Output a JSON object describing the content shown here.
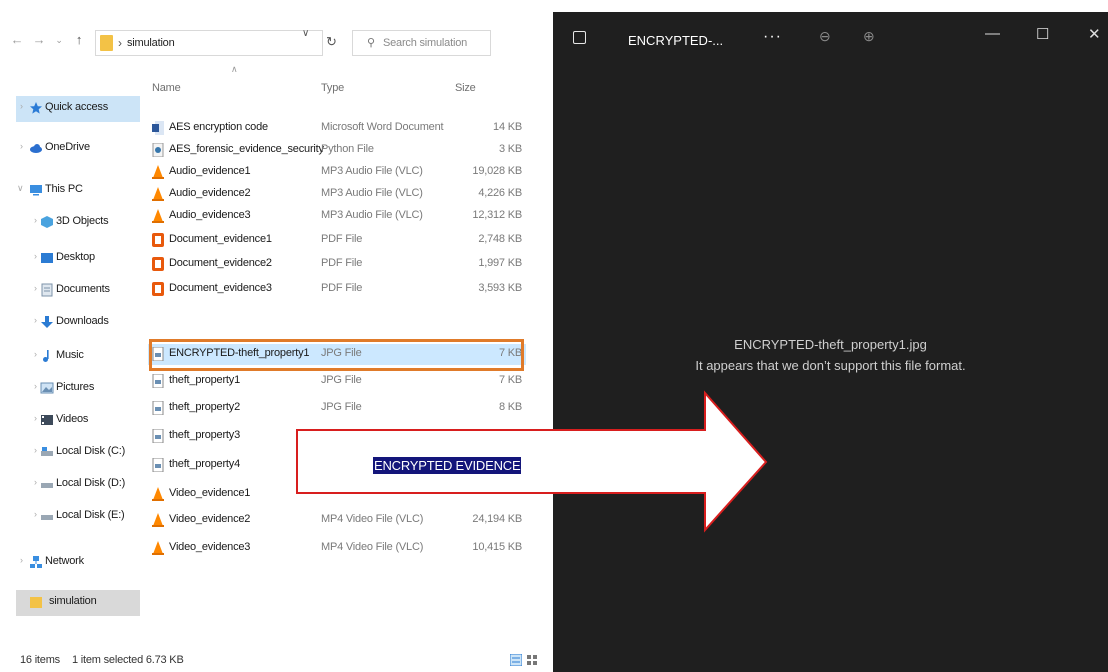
{
  "explorer": {
    "address": {
      "crumb": "simulation",
      "sep": "›"
    },
    "search": {
      "placeholder": "Search simulation"
    },
    "columns": {
      "name": "Name",
      "type": "Type",
      "size": "Size"
    },
    "nav": [
      {
        "label": "Quick access",
        "icon": "star-icon"
      },
      {
        "label": "OneDrive",
        "icon": "cloud-icon"
      },
      {
        "label": "This PC",
        "icon": "computer-icon"
      },
      {
        "label": "3D Objects",
        "icon": "cube-icon"
      },
      {
        "label": "Desktop",
        "icon": "desktop-icon"
      },
      {
        "label": "Documents",
        "icon": "document-icon"
      },
      {
        "label": "Downloads",
        "icon": "download-icon"
      },
      {
        "label": "Music",
        "icon": "music-icon"
      },
      {
        "label": "Pictures",
        "icon": "pictures-icon"
      },
      {
        "label": "Videos",
        "icon": "videos-icon"
      },
      {
        "label": "Local Disk (C:)",
        "icon": "disk-icon"
      },
      {
        "label": "Local Disk (D:)",
        "icon": "disk-icon"
      },
      {
        "label": "Local Disk (E:)",
        "icon": "disk-icon"
      },
      {
        "label": "Network",
        "icon": "network-icon"
      },
      {
        "label": "simulation",
        "icon": "folder-icon"
      }
    ],
    "files": [
      {
        "name": "AES encryption code",
        "type": "Microsoft Word Document",
        "size": "14 KB",
        "icon": "word-icon"
      },
      {
        "name": "AES_forensic_evidence_security",
        "type": "Python File",
        "size": "3 KB",
        "icon": "python-icon"
      },
      {
        "name": "Audio_evidence1",
        "type": "MP3 Audio File (VLC)",
        "size": "19,028 KB",
        "icon": "vlc-icon"
      },
      {
        "name": "Audio_evidence2",
        "type": "MP3 Audio File (VLC)",
        "size": "4,226 KB",
        "icon": "vlc-icon"
      },
      {
        "name": "Audio_evidence3",
        "type": "MP3 Audio File (VLC)",
        "size": "12,312 KB",
        "icon": "vlc-icon"
      },
      {
        "name": "Document_evidence1",
        "type": "PDF File",
        "size": "2,748 KB",
        "icon": "pdf-icon"
      },
      {
        "name": "Document_evidence2",
        "type": "PDF File",
        "size": "1,997 KB",
        "icon": "pdf-icon"
      },
      {
        "name": "Document_evidence3",
        "type": "PDF File",
        "size": "3,593 KB",
        "icon": "pdf-icon"
      },
      {
        "name": "ENCRYPTED-theft_property1",
        "type": "JPG File",
        "size": "7 KB",
        "icon": "image-icon"
      },
      {
        "name": "theft_property1",
        "type": "JPG File",
        "size": "7 KB",
        "icon": "image-icon"
      },
      {
        "name": "theft_property2",
        "type": "JPG File",
        "size": "8 KB",
        "icon": "image-icon"
      },
      {
        "name": "theft_property3",
        "type": "",
        "size": "",
        "icon": "image-icon"
      },
      {
        "name": "theft_property4",
        "type": "",
        "size": "",
        "icon": "image-icon"
      },
      {
        "name": "Video_evidence1",
        "type": "",
        "size": "",
        "icon": "vlc-icon"
      },
      {
        "name": "Video_evidence2",
        "type": "MP4 Video File (VLC)",
        "size": "24,194 KB",
        "icon": "vlc-icon"
      },
      {
        "name": "Video_evidence3",
        "type": "MP4 Video File (VLC)",
        "size": "10,415 KB",
        "icon": "vlc-icon"
      }
    ],
    "status": {
      "count": "16 items",
      "selection": "1 item selected  6.73 KB"
    }
  },
  "viewer": {
    "title": "ENCRYPTED-...",
    "more": "···",
    "zoom_out": "⊖",
    "zoom_in": "⊕",
    "minimize": "—",
    "maximize": "☐",
    "close": "✕",
    "filename": "ENCRYPTED-theft_property1.jpg",
    "message": "It appears that we don’t support this file format."
  },
  "annotation": {
    "label": "ENCRYPTED EVIDENCE"
  },
  "colors": {
    "highlight_border": "#e07b2a",
    "arrow_border": "#d81e1e",
    "label_bg": "#13157a",
    "viewer_bg": "#1f1f1f",
    "selection": "#cce8ff"
  }
}
